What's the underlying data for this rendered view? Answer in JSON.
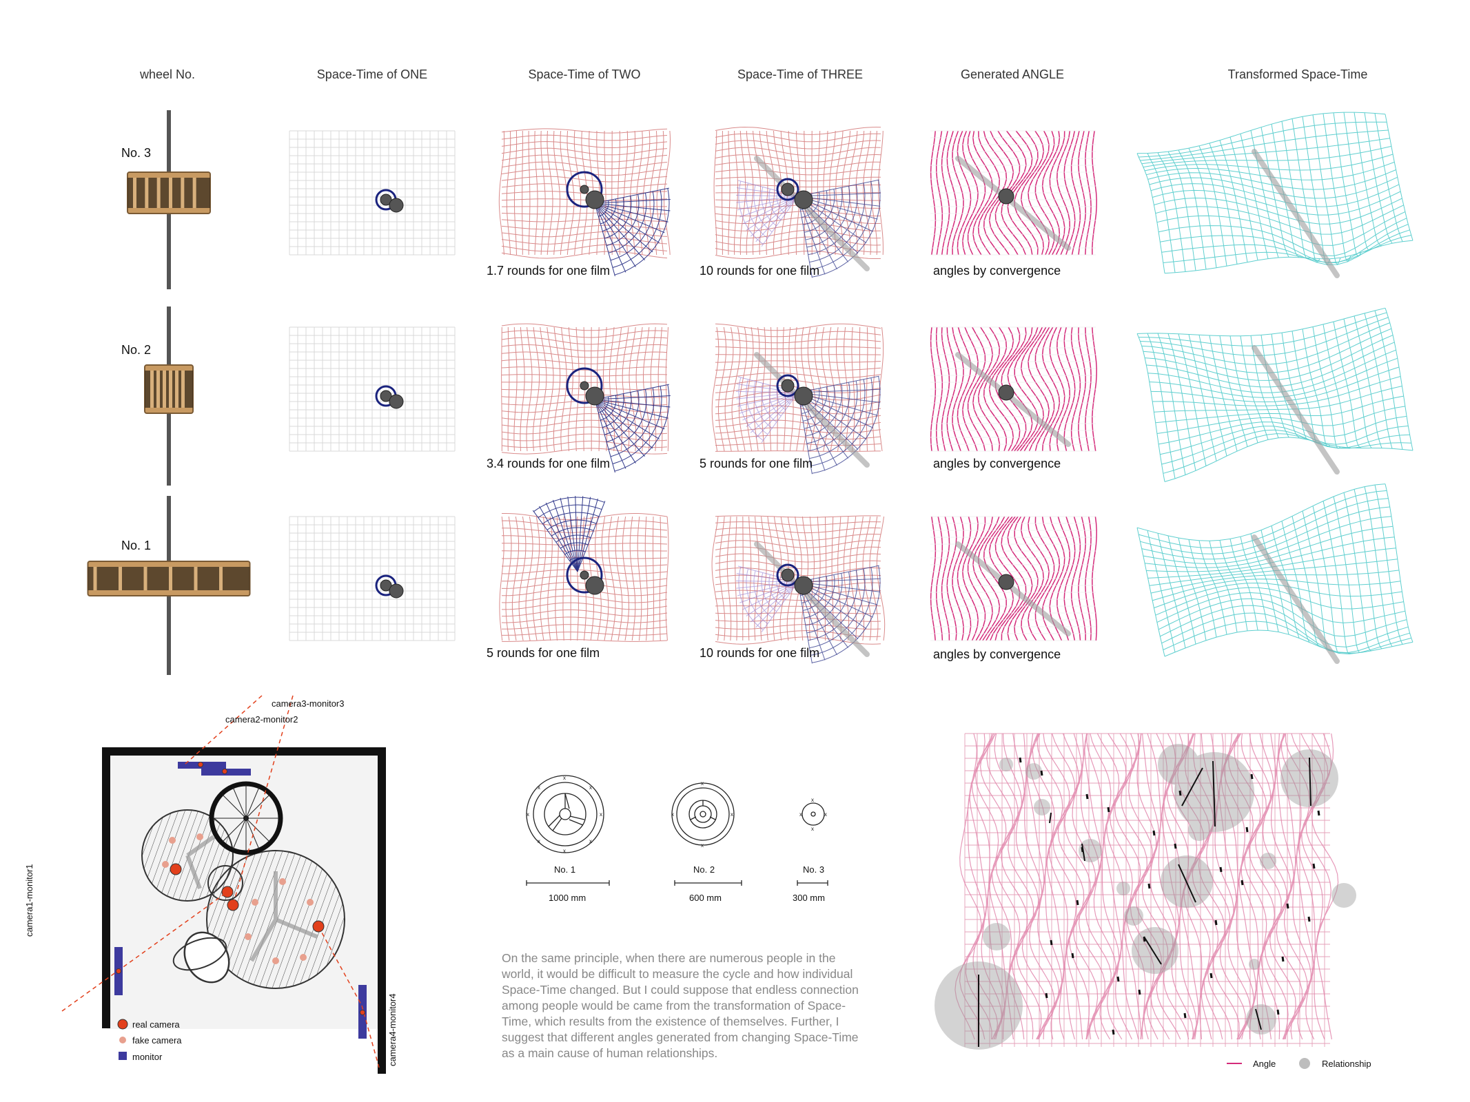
{
  "headers": {
    "wheel": "wheel No.",
    "one": "Space-Time of ONE",
    "two": "Space-Time of TWO",
    "three": "Space-Time of THREE",
    "angle": "Generated ANGLE",
    "transformed": "Transformed Space-Time"
  },
  "rows": [
    {
      "wheel": "No. 3",
      "two_caption": "1.7 rounds for one film",
      "three_caption": "10 rounds for one film",
      "angle_caption": "angles by convergence"
    },
    {
      "wheel": "No. 2",
      "two_caption": "3.4 rounds for one film",
      "three_caption": "5 rounds for one film",
      "angle_caption": "angles by convergence"
    },
    {
      "wheel": "No. 1",
      "two_caption": "5 rounds for one film",
      "three_caption": "10 rounds for one film",
      "angle_caption": "angles by convergence"
    }
  ],
  "plan": {
    "labels": [
      "camera3-monitor3",
      "camera2-monitor2",
      "camera1-monitor1",
      "camera4-monitor4"
    ],
    "legend": [
      "real camera",
      "fake camera",
      "monitor"
    ]
  },
  "wheel_sizes": [
    {
      "name": "No. 1",
      "size": "1000 mm"
    },
    {
      "name": "No. 2",
      "size": "600 mm"
    },
    {
      "name": "No. 3",
      "size": "300 mm"
    }
  ],
  "paragraph": "On the same principle, when there are numerous people in the world, it would be difficult to measure the cycle and how individual Space-Time changed. But I could suppose that endless connection among people would be came from the transformation of Space-Time, which results from the existence of themselves. Further, I suggest that different angles generated from changing Space-Time as a main cause of human relationships.",
  "legend": {
    "angle": "Angle",
    "relationship": "Relationship"
  },
  "colors": {
    "grid_gray": "#d8d8d8",
    "grid_red": "#d98a8a",
    "magenta": "#d42a7a",
    "navy": "#1a237e",
    "cyan": "#5fcfcf",
    "plywood": "#c89a62",
    "orange": "#e2401c",
    "monitor": "#3d3a9e"
  }
}
